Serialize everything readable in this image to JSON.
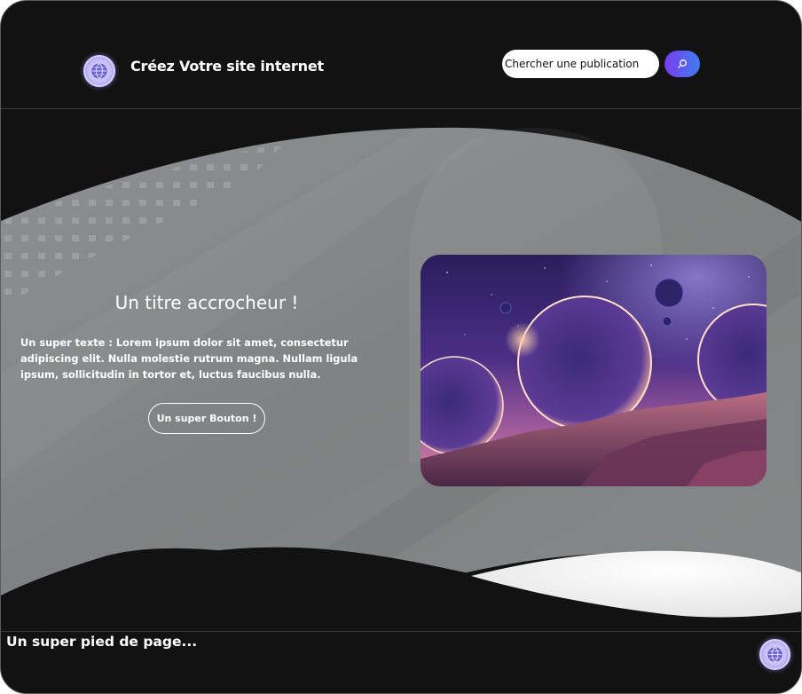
{
  "header": {
    "site_title": "Créez Votre site internet",
    "search": {
      "placeholder": "Chercher une publication",
      "value": ""
    },
    "search_button_icon": "search-icon",
    "logo_icon": "globe-icon"
  },
  "hero": {
    "title": "Un titre accrocheur !",
    "text_lead": "Un super texte :",
    "text_body": " Lorem ipsum dolor sit amet, consectetur adipiscing elit. Nulla molestie rutrum magna. Nullam ligula ipsum, sollicitudin in tortor et, luctus faucibus nulla.",
    "button_label": "Un super Bouton !",
    "image": "space-planets-illustration"
  },
  "footer": {
    "text": "Un super pied de page...",
    "logo_icon": "globe-icon"
  },
  "colors": {
    "background": "#121212",
    "hero_gray": "#808383",
    "accent_purple": "#7b3cf0",
    "accent_blue": "#3f7cf0",
    "text": "#ffffff"
  }
}
